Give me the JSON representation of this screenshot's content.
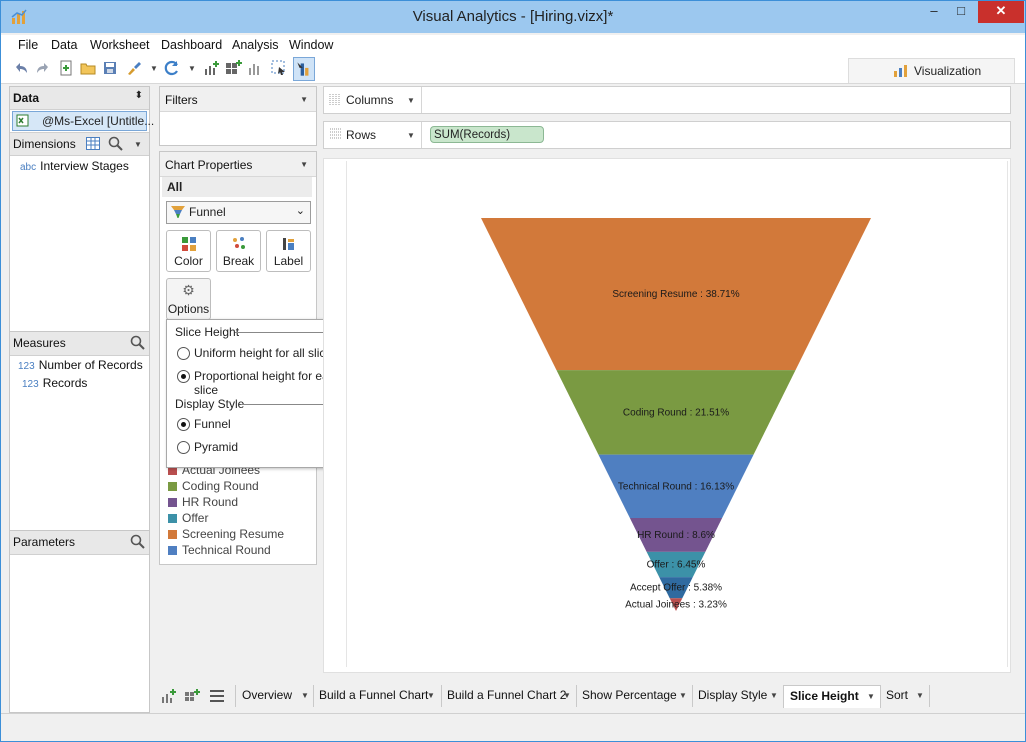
{
  "window": {
    "title": "Visual Analytics - [Hiring.vizx]*",
    "minimize": "–",
    "maximize": "□",
    "close": "✕"
  },
  "menu": [
    "File",
    "Data",
    "Worksheet",
    "Dashboard",
    "Analysis",
    "Window"
  ],
  "visualization_tab": "Visualization",
  "data_panel": {
    "title": "Data",
    "datasource": "@Ms-Excel [Untitle..."
  },
  "dimensions": {
    "title": "Dimensions",
    "items": [
      {
        "type": "abc",
        "label": "Interview Stages"
      }
    ]
  },
  "measures": {
    "title": "Measures",
    "items": [
      {
        "type": "123",
        "label": "Number of Records"
      },
      {
        "type": "123",
        "label": "Records"
      }
    ]
  },
  "parameters": {
    "title": "Parameters"
  },
  "filters": {
    "title": "Filters"
  },
  "chart_properties": {
    "title": "Chart Properties",
    "scope": "All",
    "chart_type": "Funnel",
    "buttons": [
      "Color",
      "Break",
      "Label",
      "Options"
    ]
  },
  "slice_popup": {
    "slice_height_title": "Slice Height",
    "uniform": "Uniform height for all slices",
    "proportional": "Proportional height for each slice",
    "display_style_title": "Display Style",
    "funnel": "Funnel",
    "pyramid": "Pyramid",
    "selected_height": "proportional",
    "selected_style": "funnel"
  },
  "legend": [
    {
      "label": "Actual Joinees",
      "color": "#b94f4f"
    },
    {
      "label": "Coding Round",
      "color": "#7a9a42"
    },
    {
      "label": "HR Round",
      "color": "#74548f"
    },
    {
      "label": "Offer",
      "color": "#3c91a8"
    },
    {
      "label": "Screening Resume",
      "color": "#d2793a"
    },
    {
      "label": "Technical Round",
      "color": "#4f7fc1"
    }
  ],
  "shelves": {
    "columns": "Columns",
    "rows": "Rows",
    "rows_pill": "SUM(Records)"
  },
  "chart_data": {
    "type": "funnel",
    "display_style": "Funnel",
    "slice_height": "Proportional",
    "slices": [
      {
        "label": "Screening Resume",
        "value": 38.71,
        "text": "Screening Resume : 38.71%",
        "color": "#d2793a"
      },
      {
        "label": "Coding Round",
        "value": 21.51,
        "text": "Coding Round : 21.51%",
        "color": "#7a9a42"
      },
      {
        "label": "Technical Round",
        "value": 16.13,
        "text": "Technical Round : 16.13%",
        "color": "#4f7fc1"
      },
      {
        "label": "HR Round",
        "value": 8.6,
        "text": "HR Round : 8.6%",
        "color": "#74548f"
      },
      {
        "label": "Offer",
        "value": 6.45,
        "text": "Offer : 6.45%",
        "color": "#3c91a8"
      },
      {
        "label": "Accept Offer",
        "value": 5.38,
        "text": "Accept Offer : 5.38%",
        "color": "#2f6aa0"
      },
      {
        "label": "Actual Joinees",
        "value": 3.23,
        "text": "Actual Joinees : 3.23%",
        "color": "#b94f4f"
      }
    ]
  },
  "sheet_tabs": [
    "Overview",
    "Build a Funnel Chart",
    "Build a Funnel Chart 2",
    "Show Percentage",
    "Display Style",
    "Slice Height",
    "Sort"
  ],
  "active_sheet": "Slice Height"
}
